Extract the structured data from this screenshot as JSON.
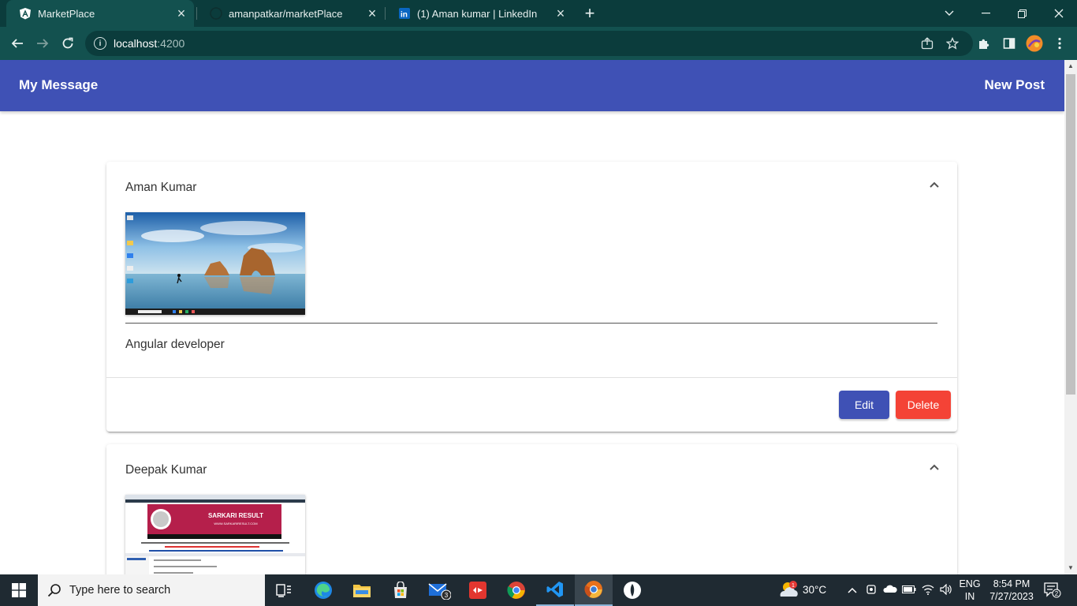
{
  "browser": {
    "tabs": [
      {
        "title": "MarketPlace",
        "favicon": "angular-icon"
      },
      {
        "title": "amanpatkar/marketPlace",
        "favicon": "github-icon"
      },
      {
        "title": "(1) Aman kumar | LinkedIn",
        "favicon": "linkedin-icon"
      }
    ],
    "new_tab": "+",
    "url_host": "localhost",
    "url_port": ":4200"
  },
  "app": {
    "brand": "My Message",
    "new_post": "New Post",
    "accent_color": "#3f51b5",
    "warn_color": "#f44336"
  },
  "posts": [
    {
      "author": "Aman Kumar",
      "content": "Angular developer",
      "image": "desktop-screenshot-beach",
      "edit_label": "Edit",
      "delete_label": "Delete"
    },
    {
      "author": "Deepak Kumar",
      "image": "sarkari-result-screenshot",
      "image_heading": "SARKARI RESULT",
      "image_subheading": "WWW.SARKARIRESULT.COM"
    }
  ],
  "taskbar": {
    "search_placeholder": "Type here to search",
    "weather_badge": "1",
    "temperature": "30°C",
    "lang_line1": "ENG",
    "lang_line2": "IN",
    "time": "8:54 PM",
    "date": "7/27/2023",
    "notification_count": "2",
    "mail_badge": "3"
  }
}
